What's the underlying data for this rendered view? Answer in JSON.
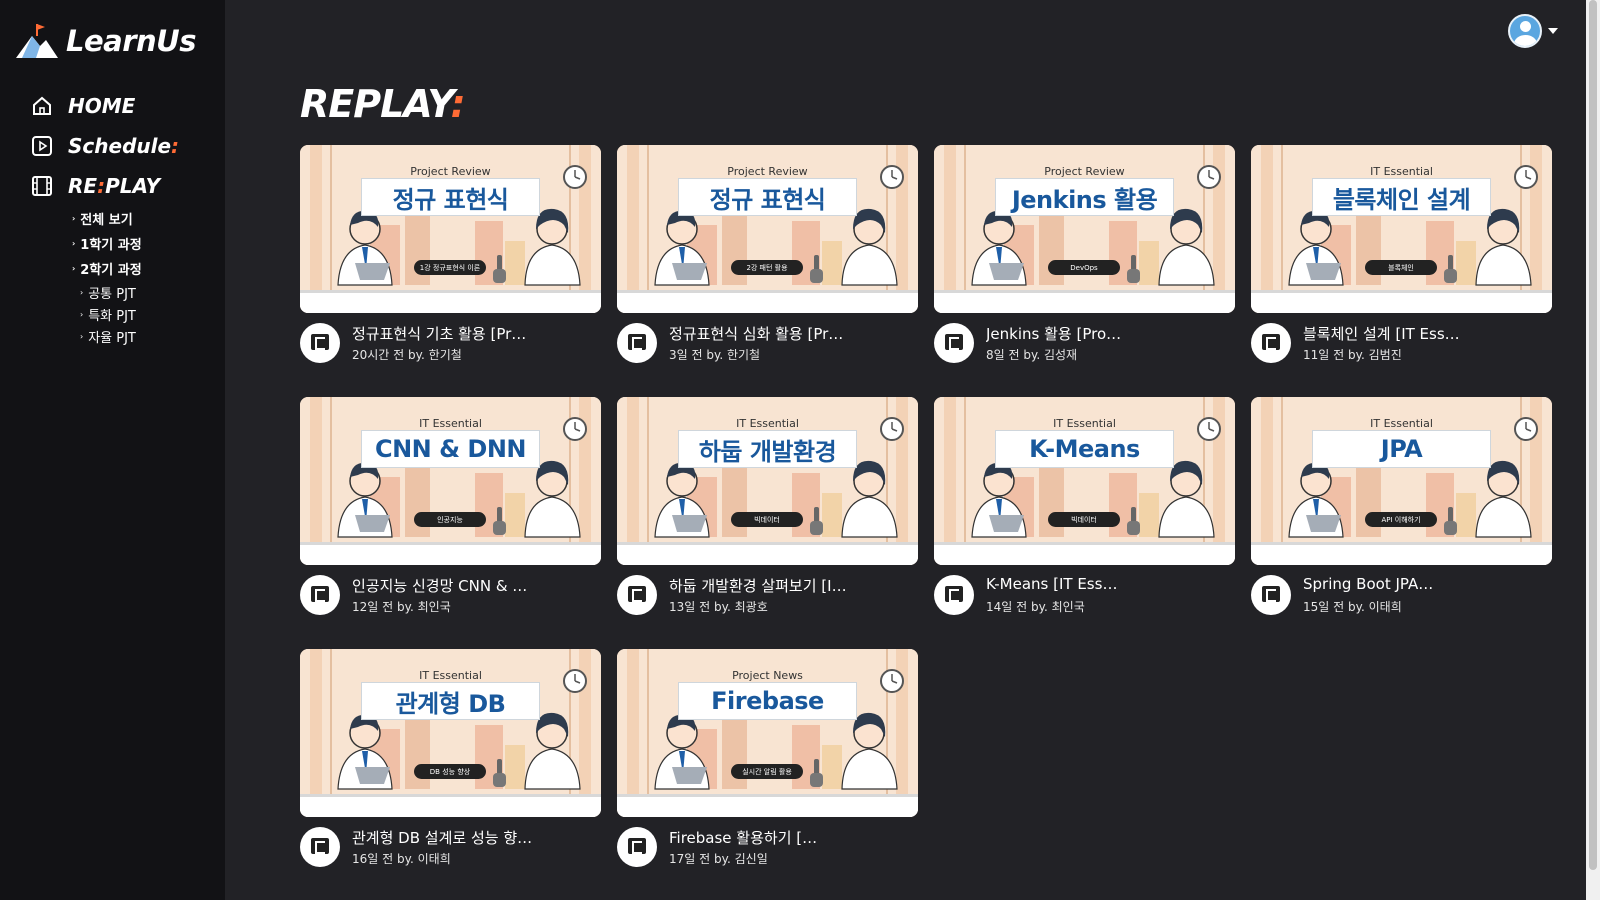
{
  "brand": {
    "name": "LearnUs",
    "accent": "#ff6b35"
  },
  "nav": {
    "home": "HOME",
    "schedule": "Schedule",
    "schedule_colon": ":",
    "replay_a": "RE",
    "replay_colon": ":",
    "replay_b": "PLAY",
    "sub": [
      "전체 보기",
      "1학기 과정",
      "2학기 과정"
    ],
    "sub2": [
      "공통 PJT",
      "특화 PJT",
      "자율 PJT"
    ]
  },
  "page": {
    "title": "REPLAY",
    "title_colon": ":"
  },
  "videos": [
    {
      "category": "Project Review",
      "thumb_title": "정규 표현식",
      "pill": "1강 정규표현식 이론",
      "title": "정규표현식 기초 활용 [Pr…",
      "sub": "20시간 전 by. 한기철"
    },
    {
      "category": "Project Review",
      "thumb_title": "정규 표현식",
      "pill": "2강 패턴 활용",
      "title": "정규표현식 심화 활용 [Pr…",
      "sub": "3일 전 by. 한기철"
    },
    {
      "category": "Project Review",
      "thumb_title": "Jenkins 활용",
      "pill": "DevOps",
      "title": "Jenkins 활용 [Pro…",
      "sub": "8일 전 by. 김성재"
    },
    {
      "category": "IT Essential",
      "thumb_title": "블록체인 설계",
      "pill": "블록체인",
      "title": "블록체인 설계 [IT Ess…",
      "sub": "11일 전 by. 김범진"
    },
    {
      "category": "IT Essential",
      "thumb_title": "CNN & DNN",
      "pill": "인공지능",
      "title": "인공지능 신경망 CNN & …",
      "sub": "12일 전 by. 최인국"
    },
    {
      "category": "IT Essential",
      "thumb_title": "하둡 개발환경",
      "pill": "빅데이터",
      "title": "하둡 개발환경 살펴보기 [I…",
      "sub": "13일 전 by. 최광호"
    },
    {
      "category": "IT Essential",
      "thumb_title": "K-Means",
      "pill": "빅데이터",
      "title": "K-Means [IT Ess…",
      "sub": "14일 전 by. 최인국"
    },
    {
      "category": "IT Essential",
      "thumb_title": "JPA",
      "pill": "API 이해하기",
      "title": "Spring Boot JPA…",
      "sub": "15일 전 by. 이태희"
    },
    {
      "category": "IT Essential",
      "thumb_title": "관계형 DB",
      "pill": "DB 성능 향상",
      "title": "관계형 DB 설계로 성능 향…",
      "sub": "16일 전 by. 이태희"
    },
    {
      "category": "Project News",
      "thumb_title": "Firebase",
      "pill": "실시간 알림 활용",
      "title": "Firebase 활용하기 […",
      "sub": "17일 전 by. 김신일"
    }
  ]
}
